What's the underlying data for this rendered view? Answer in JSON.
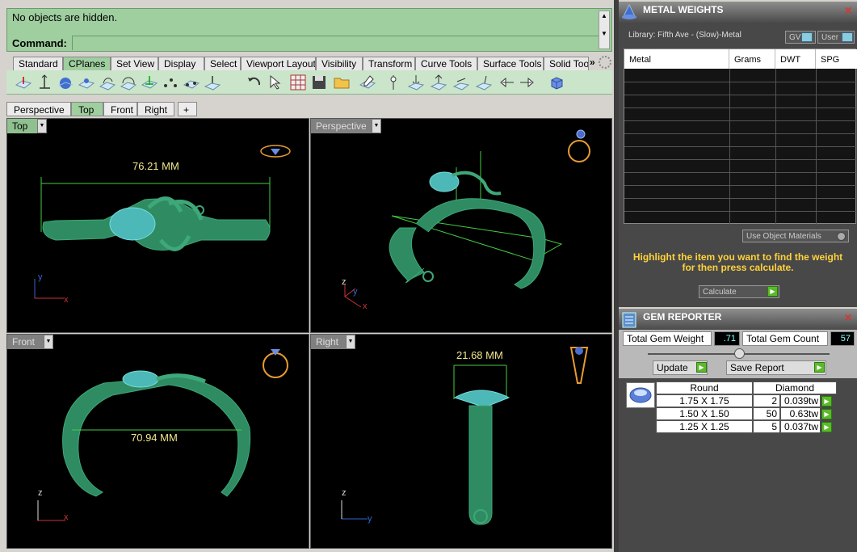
{
  "command": {
    "history_text": "No objects are hidden.",
    "prompt_label": "Command:",
    "input_value": ""
  },
  "toolbar_tabs": [
    "Standard",
    "CPlanes",
    "Set View",
    "Display",
    "Select",
    "Viewport Layout",
    "Visibility",
    "Transform",
    "Curve Tools",
    "Surface Tools",
    "Solid Too"
  ],
  "toolbar_tabs_more": "»",
  "viewport_tabs": [
    "Perspective",
    "Top",
    "Front",
    "Right"
  ],
  "viewport_tab_add": "+",
  "viewports": {
    "top": {
      "label": "Top",
      "dimension": "76.21 MM",
      "axis_y": "y",
      "axis_x": "x"
    },
    "perspective": {
      "label": "Perspective",
      "axis_z": "z",
      "axis_y": "y",
      "axis_x": "x"
    },
    "front": {
      "label": "Front",
      "dimension": "70.94 MM",
      "axis_z": "z",
      "axis_x": "x"
    },
    "right": {
      "label": "Right",
      "dimension": "21.68 MM",
      "axis_z": "z",
      "axis_y": "y"
    }
  },
  "metal_weights": {
    "title": "METAL WEIGHTS",
    "library": "Library: Fifth Ave - (Slow)-Metal",
    "gv_label": "GV",
    "user_label": "User",
    "columns": [
      "Metal",
      "Grams",
      "DWT",
      "SPG"
    ],
    "use_object_materials": "Use Object Materials",
    "instruction_line1": "Highlight the item you want to find the weight",
    "instruction_line2": "for then press calculate.",
    "calculate_label": "Calculate"
  },
  "gem_reporter": {
    "title": "GEM REPORTER",
    "total_weight_label": "Total Gem Weight",
    "total_weight_value": ".71",
    "total_count_label": "Total Gem Count",
    "total_count_value": "57",
    "update_label": "Update",
    "save_report_label": "Save Report",
    "table_headers": [
      "Round",
      "Diamond"
    ],
    "rows": [
      {
        "size": "1.75 X 1.75",
        "count": "2",
        "weight": "0.039tw"
      },
      {
        "size": "1.50 X 1.50",
        "count": "50",
        "weight": "0.63tw"
      },
      {
        "size": "1.25 X 1.25",
        "count": "5",
        "weight": "0.037tw"
      }
    ]
  },
  "colors": {
    "accent_green": "#9fce9f",
    "model_green": "#2e8b62",
    "dimension_yellow": "#f0e68c",
    "instruction_yellow": "#ffd23a"
  }
}
